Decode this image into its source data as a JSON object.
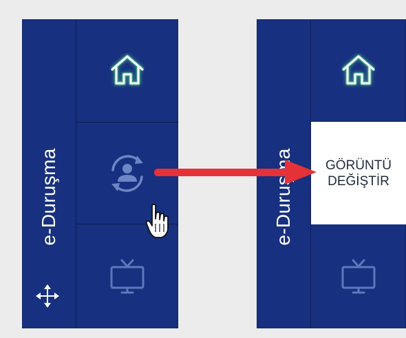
{
  "left_panel": {
    "title": "e-Duruşma",
    "items": [
      {
        "name": "home",
        "icon": "home-icon"
      },
      {
        "name": "switch-view",
        "icon": "user-rotate-icon"
      },
      {
        "name": "tv",
        "icon": "tv-icon"
      }
    ],
    "move_icon": "move-icon"
  },
  "right_panel": {
    "title": "e-Duruşma",
    "switch_label_line1": "GÖRÜNTÜ",
    "switch_label_line2": "DEĞİŞTİR"
  },
  "colors": {
    "panel_bg": "#17307f",
    "home_icon": "#e8fff0",
    "home_glow": "#56e08a",
    "muted_icon": "#6c84c4",
    "arrow": "#e53238",
    "background": "#ececec"
  }
}
